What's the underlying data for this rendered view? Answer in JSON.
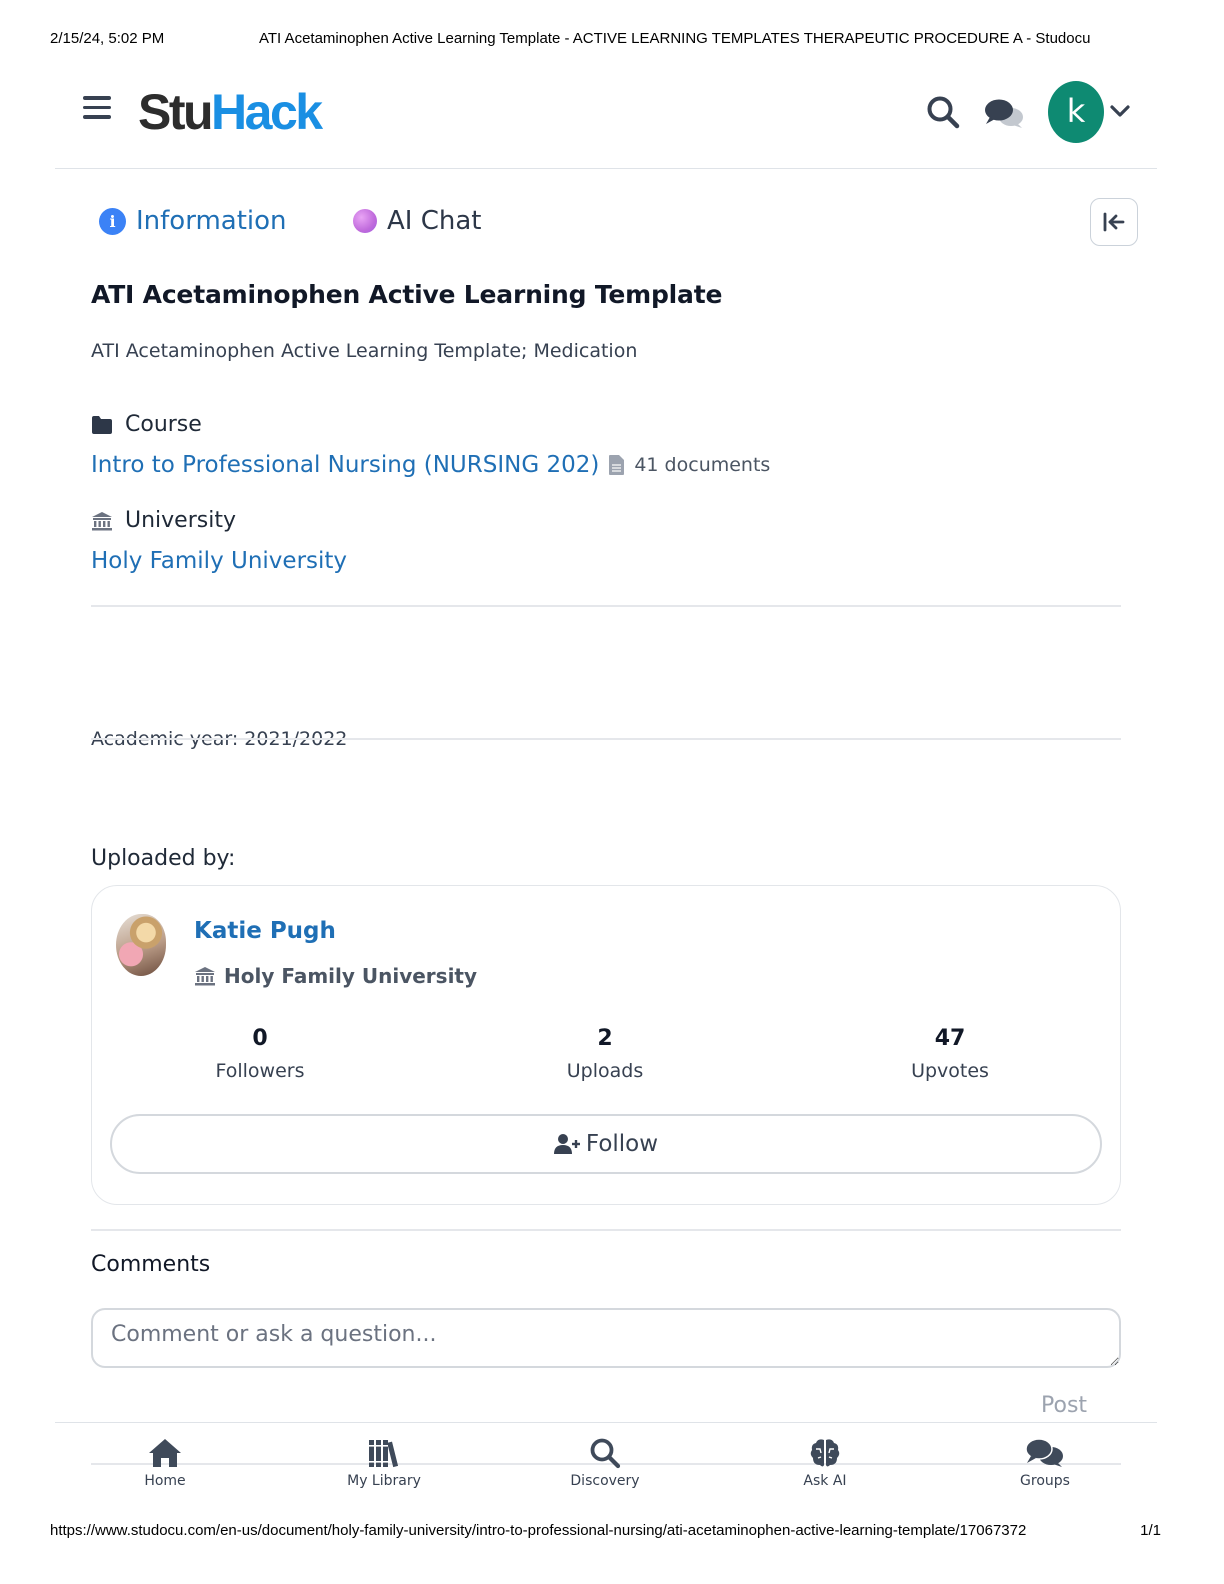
{
  "print_header": {
    "date": "2/15/24, 5:02 PM",
    "title": "ATI Acetaminophen Active Learning Template - ACTIVE LEARNING TEMPLATES THERAPEUTIC PROCEDURE A - Studocu"
  },
  "print_footer": {
    "url": "https://www.studocu.com/en-us/document/holy-family-university/intro-to-professional-nursing/ati-acetaminophen-active-learning-template/17067372",
    "page": "1/1"
  },
  "topbar": {
    "logo_part1": "Stu",
    "logo_part2": "Hack",
    "avatar_letter": "k",
    "icons": [
      "hamburger-icon",
      "search-icon",
      "chat-icon",
      "chevron-down-icon"
    ],
    "accent_color": "#1a8fe3",
    "avatar_color": "#0e8a72"
  },
  "tabs": {
    "information": "Information",
    "ai_chat": "AI Chat"
  },
  "document": {
    "title": "ATI Acetaminophen Active Learning Template",
    "description": "ATI Acetaminophen Active Learning Template; Medication",
    "course_label": "Course",
    "course_name": "Intro to Professional Nursing (NURSING 202)",
    "course_doc_count": "41 documents",
    "university_label": "University",
    "university_name": "Holy Family University",
    "academic_year": "Academic year: 2021/2022"
  },
  "uploader": {
    "heading": "Uploaded by:",
    "name": "Katie Pugh",
    "university": "Holy Family University",
    "stats": [
      {
        "value": "0",
        "label": "Followers"
      },
      {
        "value": "2",
        "label": "Uploads"
      },
      {
        "value": "47",
        "label": "Upvotes"
      }
    ],
    "follow_label": "Follow"
  },
  "comments": {
    "heading": "Comments",
    "placeholder": "Comment or ask a question...",
    "post_label": "Post"
  },
  "bottom_nav": [
    {
      "label": "Home",
      "icon": "home-icon"
    },
    {
      "label": "My Library",
      "icon": "library-icon"
    },
    {
      "label": "Discovery",
      "icon": "search-icon"
    },
    {
      "label": "Ask AI",
      "icon": "brain-icon"
    },
    {
      "label": "Groups",
      "icon": "comments-icon"
    }
  ]
}
